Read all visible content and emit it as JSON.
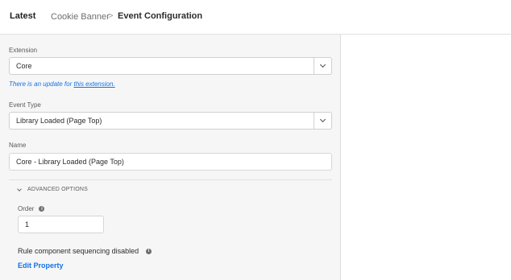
{
  "header": {
    "latest_label": "Latest",
    "breadcrumb": "Cookie Banner",
    "separator": ">",
    "title": "Event Configuration"
  },
  "form": {
    "extension": {
      "label": "Extension",
      "value": "Core",
      "update_text": "There is an update for ",
      "update_link": "this extension."
    },
    "event_type": {
      "label": "Event Type",
      "value": "Library Loaded (Page Top)"
    },
    "name": {
      "label": "Name",
      "value": "Core - Library Loaded (Page Top)"
    },
    "advanced": {
      "toggle_label": "ADVANCED OPTIONS",
      "order_label": "Order",
      "order_value": "1",
      "sequencing_text": "Rule component sequencing disabled",
      "edit_property": "Edit Property"
    }
  },
  "icons": {
    "info": "i"
  },
  "colors": {
    "link": "#1473e6",
    "panel_bg": "#f6f6f6"
  }
}
